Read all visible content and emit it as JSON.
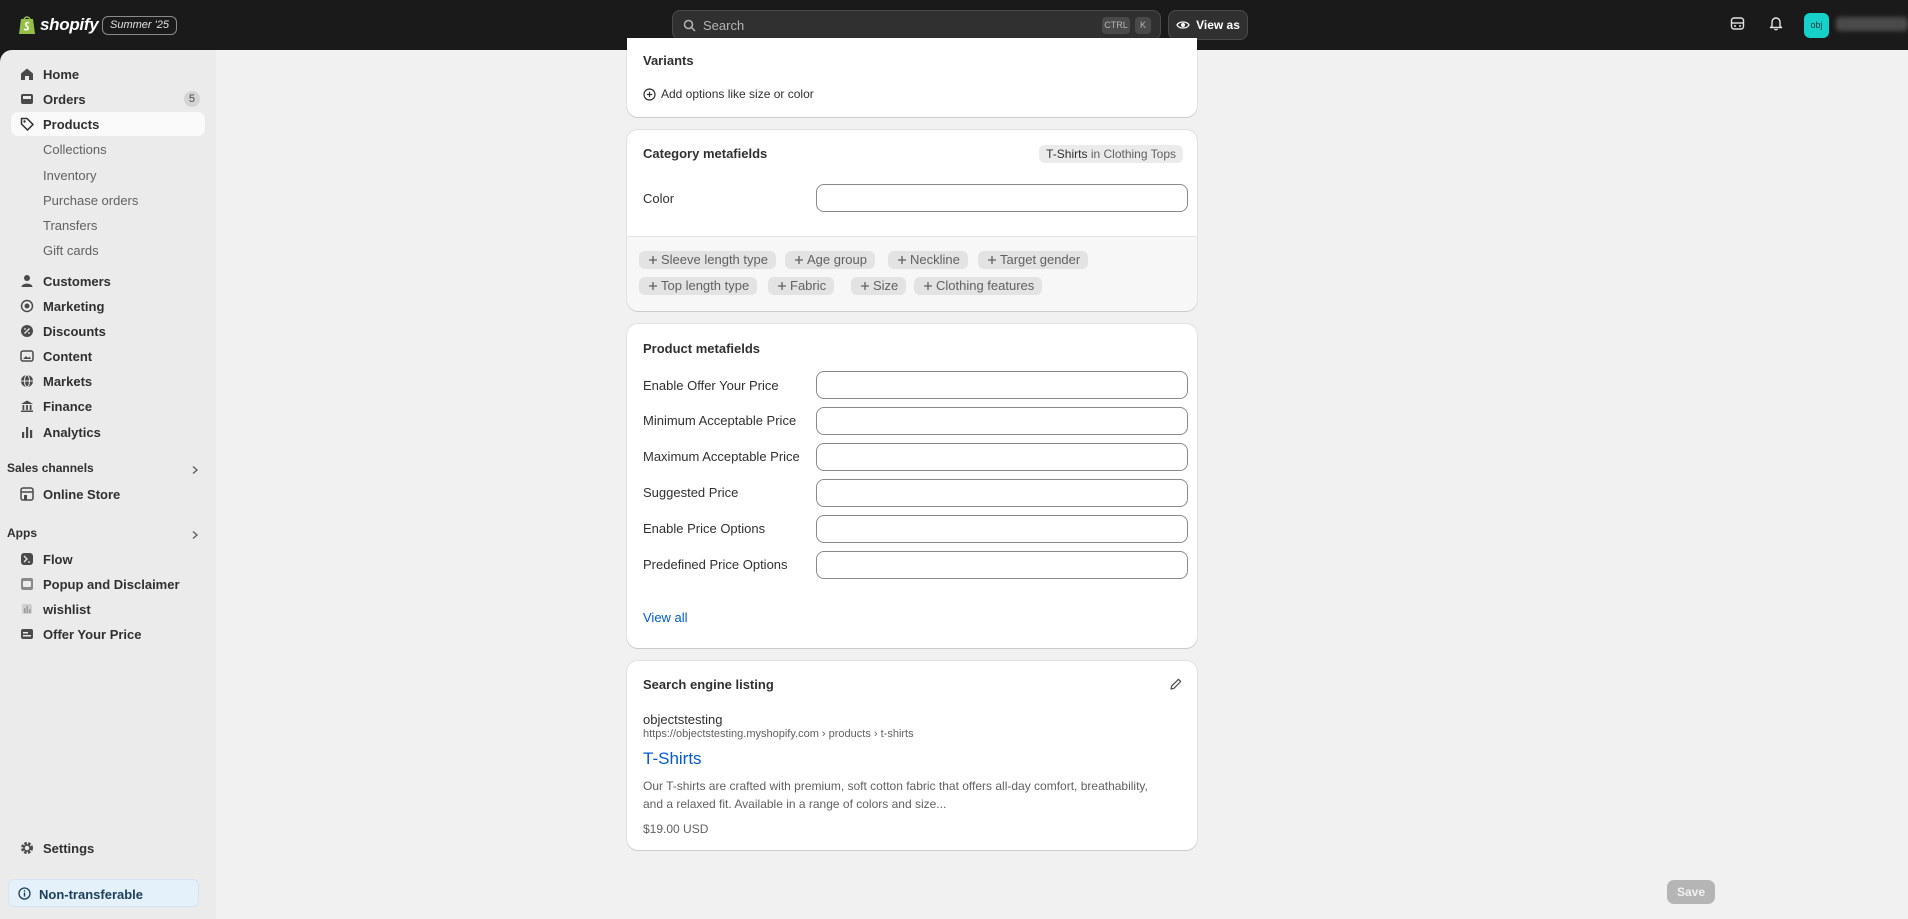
{
  "topbar": {
    "brand": "shopify",
    "edition": "Summer '25",
    "search_placeholder": "Search",
    "shortcut_ctrl": "CTRL",
    "shortcut_k": "K",
    "view_as": "View as",
    "avatar_initials": "obj"
  },
  "sidebar": {
    "home": "Home",
    "orders": "Orders",
    "orders_count": "5",
    "products": "Products",
    "collections": "Collections",
    "inventory": "Inventory",
    "purchase_orders": "Purchase orders",
    "transfers": "Transfers",
    "gift_cards": "Gift cards",
    "customers": "Customers",
    "marketing": "Marketing",
    "discounts": "Discounts",
    "content": "Content",
    "markets": "Markets",
    "finance": "Finance",
    "analytics": "Analytics",
    "sales_channels_heading": "Sales channels",
    "online_store": "Online Store",
    "apps_heading": "Apps",
    "flow": "Flow",
    "popup": "Popup and Disclaimer",
    "wishlist": "wishlist",
    "offer_your_price": "Offer Your Price",
    "settings": "Settings",
    "non_transferable": "Non-transferable"
  },
  "variants": {
    "title": "Variants",
    "add_options": "Add options like size or color"
  },
  "category_metafields": {
    "title": "Category metafields",
    "badge_term": "T-Shirts",
    "badge_rest": "in Clothing Tops",
    "color_label": "Color",
    "chips": [
      "Sleeve length type",
      "Age group",
      "Neckline",
      "Target gender",
      "Top length type",
      "Fabric",
      "Size",
      "Clothing features"
    ]
  },
  "product_metafields": {
    "title": "Product metafields",
    "fields": [
      "Enable Offer Your Price",
      "Minimum Acceptable Price",
      "Maximum Acceptable Price",
      "Suggested Price",
      "Enable Price Options",
      "Predefined Price Options"
    ],
    "view_all": "View all"
  },
  "seo": {
    "title": "Search engine listing",
    "site_name": "objectstesting",
    "url": "https://objectstesting.myshopify.com › products › t-shirts",
    "page_title": "T-Shirts",
    "description_line1": "Our T-shirts are crafted with premium, soft cotton fabric that offers all-day comfort, breathability,",
    "description_line2": "and a relaxed fit. Available in a range of colors and size...",
    "price": "$19.00 USD"
  },
  "actions": {
    "save": "Save"
  },
  "colors": {
    "topbar": "#1a1a1a",
    "sidebar": "#ebebeb",
    "main_bg": "#f1f1f1",
    "link": "#005bd3",
    "avatar": "#16d1c9"
  }
}
